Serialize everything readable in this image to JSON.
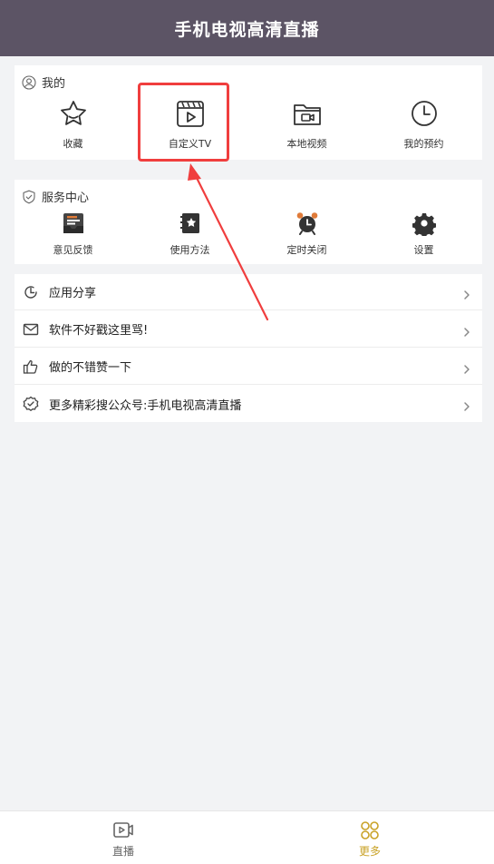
{
  "header": {
    "title": "手机电视高清直播"
  },
  "mine": {
    "heading": "我的",
    "items": [
      {
        "label": "收藏",
        "icon": "star-icon"
      },
      {
        "label": "自定义TV",
        "icon": "clapperboard-play-icon"
      },
      {
        "label": "本地视频",
        "icon": "folder-video-icon"
      },
      {
        "label": "我的预约",
        "icon": "clock-icon"
      }
    ]
  },
  "service": {
    "heading": "服务中心",
    "items": [
      {
        "label": "意见反馈",
        "icon": "feedback-mailbox-icon"
      },
      {
        "label": "使用方法",
        "icon": "manual-book-icon"
      },
      {
        "label": "定时关闭",
        "icon": "alarm-clock-icon"
      },
      {
        "label": "设置",
        "icon": "gear-icon"
      }
    ]
  },
  "list": [
    {
      "label": "应用分享",
      "icon": "refresh-share-icon"
    },
    {
      "label": "软件不好戳这里骂!",
      "icon": "mail-icon"
    },
    {
      "label": "做的不错赞一下",
      "icon": "thumbs-up-icon"
    },
    {
      "label": "更多精彩搜公众号:手机电视高清直播",
      "icon": "badge-check-icon"
    }
  ],
  "tabbar": {
    "tabs": [
      {
        "label": "直播",
        "icon": "tv-play-icon",
        "active": false
      },
      {
        "label": "更多",
        "icon": "grid-circles-icon",
        "active": true
      }
    ]
  },
  "colors": {
    "header_bg": "#5c5465",
    "accent_gold": "#c9a227",
    "annotation_red": "#f03e3e",
    "page_bg": "#f2f3f5"
  }
}
